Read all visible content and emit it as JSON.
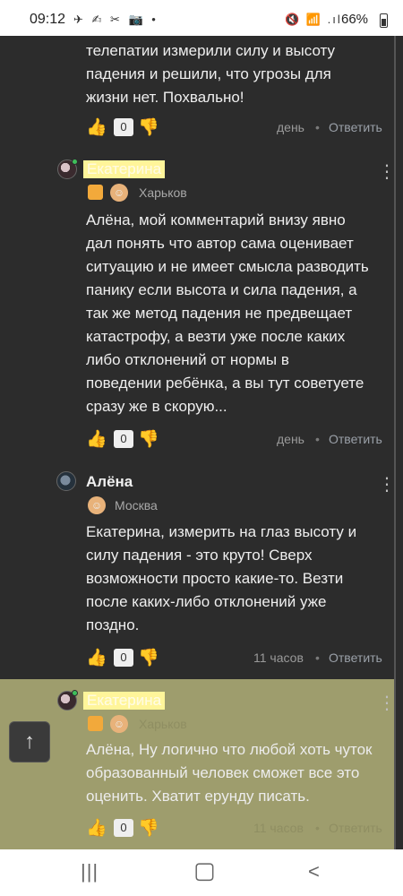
{
  "status_bar": {
    "time": "09:12",
    "notification_icons": "✈ ✍ ✂ 📷 •",
    "signal_icons": "🔇 📶 .ıl",
    "battery": "66%"
  },
  "comments": [
    {
      "text": "телепатии измерили силу и высоту\nпадения и решили, что угрозы для\nжизни нет. Похвально!",
      "likes": "0",
      "time": "день",
      "separator": "•",
      "reply": "Ответить"
    },
    {
      "author": "Екатерина",
      "city": "Харьков",
      "text": "Алёна, мой комментарий внизу явно\nдал понять что автор сама оценивает\nситуацию и не имеет смысла разводить\nпанику если высота и сила падения, а\nтак же метод падения не предвещает\nкатастрофу, а везти уже после каких\nлибо отклонений от нормы в\nповедении ребёнка, а вы тут советуете\nсразу же в скорую...",
      "likes": "0",
      "time": "день",
      "separator": "•",
      "reply": "Ответить",
      "menu": "⋮"
    },
    {
      "author": "Алёна",
      "city": "Москва",
      "text": "Екатерина, измерить на глаз высоту и\nсилу падения - это круто! Сверх\nвозможности просто какие-то. Везти\nпосле каких-либо отклонений уже\nпоздно.",
      "likes": "0",
      "time": "11 часов",
      "separator": "•",
      "reply": "Ответить",
      "menu": "⋮"
    },
    {
      "author": "Екатерина",
      "city": "Харьков",
      "text": "Алёна, Ну логично что любой хоть чуток\nобразованный человек сможет все это\nоценить. Хватит ерунду писать.",
      "likes": "0",
      "time": "11 часов",
      "separator": "•",
      "reply": "Ответить",
      "menu": "⋮"
    }
  ],
  "icons": {
    "like": "👍",
    "dislike": "👎",
    "scroll_top": "↑",
    "nav_recent": "|||",
    "nav_home": "▢",
    "nav_back": "<"
  },
  "colors": {
    "background": "#2c2c2c",
    "highlight_block": "#b3b179",
    "name_highlight": "#fff59a",
    "badge": "#f2a93b",
    "online": "#3fbf5a"
  }
}
